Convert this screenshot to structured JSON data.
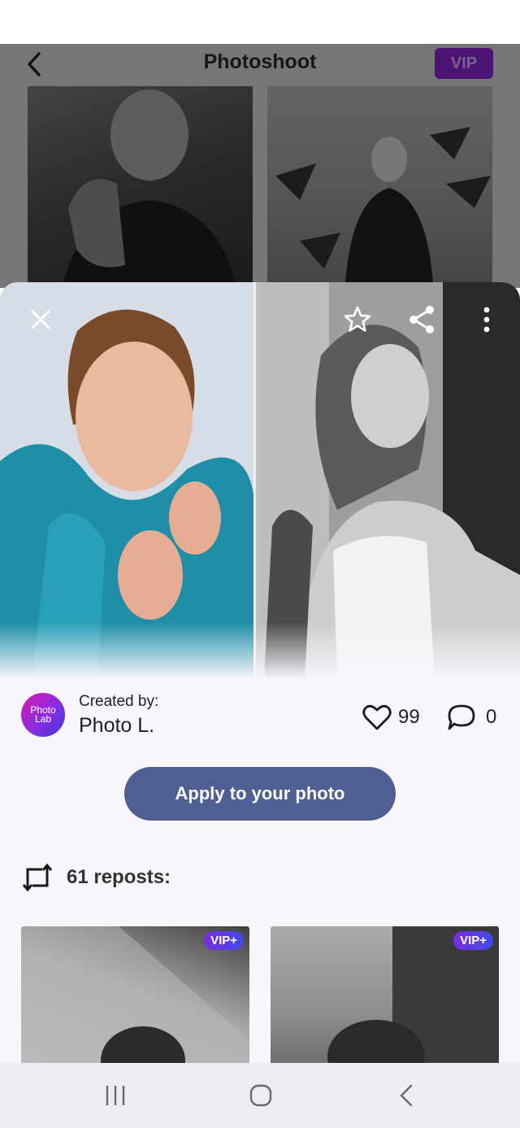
{
  "background_page": {
    "title": "Photoshoot",
    "vip_badge": "VIP",
    "back_icon": "chevron-left-icon"
  },
  "preview": {
    "close_icon": "close-icon",
    "favorite_icon": "star-outline-icon",
    "share_icon": "share-icon",
    "more_icon": "more-vertical-icon"
  },
  "creator": {
    "label": "Created by:",
    "name": "Photo L.",
    "avatar_text": "Photo Lab"
  },
  "stats": {
    "likes": "99",
    "comments": "0"
  },
  "apply_button": "Apply to your photo",
  "reposts": {
    "label": "61 reposts:",
    "items": [
      {
        "badge": "VIP+"
      },
      {
        "badge": "VIP+"
      }
    ]
  },
  "colors": {
    "accent_button": "#4d5f93",
    "vip_gradient_start": "#7a2ce0",
    "vip_gradient_end": "#3f4be8"
  },
  "system_nav": {
    "recents_icon": "recents-icon",
    "home_icon": "home-icon",
    "back_icon": "back-icon"
  }
}
